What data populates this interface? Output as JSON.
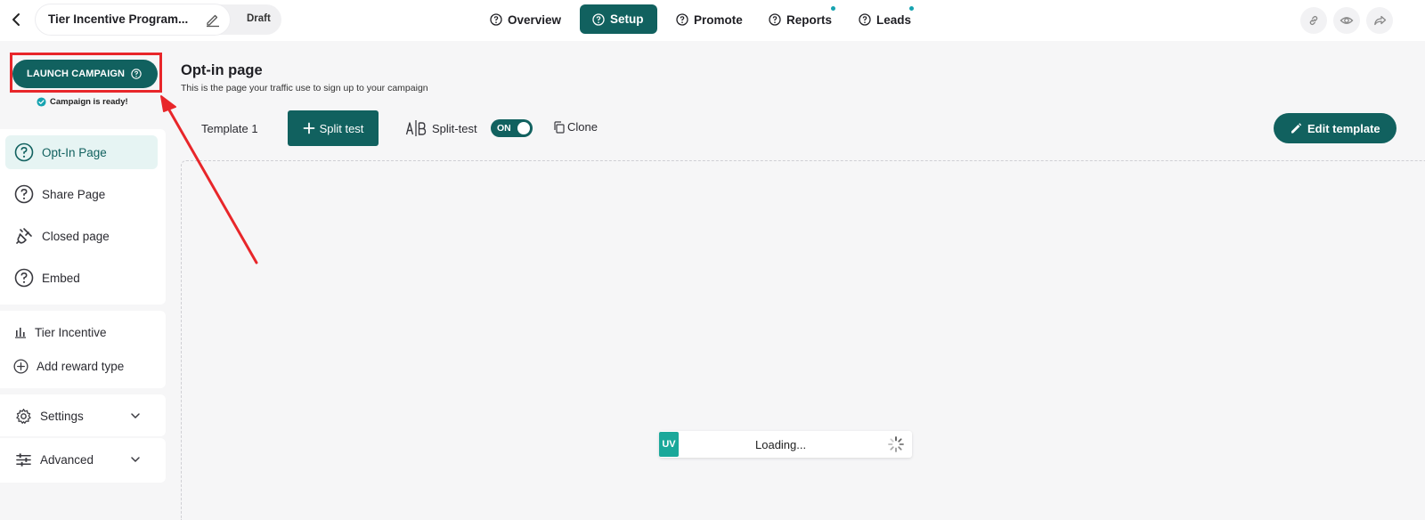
{
  "header": {
    "campaign_title": "Tier Incentive Program...",
    "status_label": "Draft",
    "nav": {
      "overview": "Overview",
      "setup": "Setup",
      "promote": "Promote",
      "reports": "Reports",
      "leads": "Leads"
    }
  },
  "sidebar": {
    "launch_label": "LAUNCH CAMPAIGN",
    "ready_text": "Campaign is ready!",
    "pages": [
      {
        "label": "Opt-In Page"
      },
      {
        "label": "Share Page"
      },
      {
        "label": "Closed page"
      },
      {
        "label": "Embed"
      }
    ],
    "rewards": {
      "tier": "Tier Incentive",
      "add": "Add reward type"
    },
    "settings_label": "Settings",
    "advanced_label": "Advanced"
  },
  "main": {
    "title": "Opt-in page",
    "subtitle": "This is the page your traffic use to sign up to your campaign",
    "template_tab": "Template 1",
    "split_test_button": "Split test",
    "split_test_label": "Split-test",
    "toggle_state": "ON",
    "clone_label": "Clone",
    "edit_template_label": "Edit template",
    "loader": {
      "badge": "UV",
      "text": "Loading..."
    }
  },
  "colors": {
    "brand": "#11615f",
    "highlight": "#e8262a",
    "accent_dot": "#16a3b0"
  }
}
